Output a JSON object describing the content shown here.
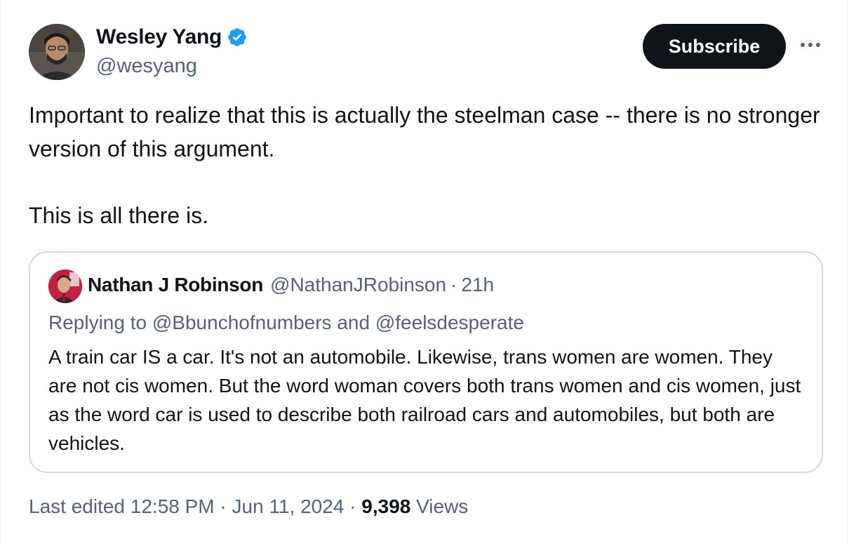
{
  "author": {
    "display_name": "Wesley Yang",
    "handle": "@wesyang",
    "verified_icon": "verified-badge-icon",
    "verified_color": "#1d9bf0"
  },
  "actions": {
    "subscribe_label": "Subscribe",
    "more_icon": "more-horizontal-icon"
  },
  "tweet": {
    "paragraphs": [
      "Important to realize that this is actually the steelman case -- there is no stronger version of this argument.",
      "This is all there is."
    ]
  },
  "quoted_tweet": {
    "display_name": "Nathan J Robinson",
    "handle": "@NathanJRobinson",
    "separator": "·",
    "time": "21h",
    "replying_prefix": "Replying to",
    "replying_user_1": "@Bbunchofnumbers",
    "replying_and": "and",
    "replying_user_2": "@feelsdesperate",
    "text": "A train car IS a car. It's not an automobile. Likewise, trans women are women. They are not cis women. But the word woman covers both trans women and cis women, just as the word car is used to describe both railroad cars and automobiles, but both are vehicles."
  },
  "meta": {
    "edited_label": "Last edited",
    "time": "12:58 PM",
    "separator": "·",
    "date": "Jun 11, 2024",
    "views_count": "9,398",
    "views_label": "Views"
  },
  "colors": {
    "text_primary": "#0f1419",
    "text_secondary": "#536471",
    "border": "#cfd9de",
    "button_bg": "#0f1419"
  }
}
